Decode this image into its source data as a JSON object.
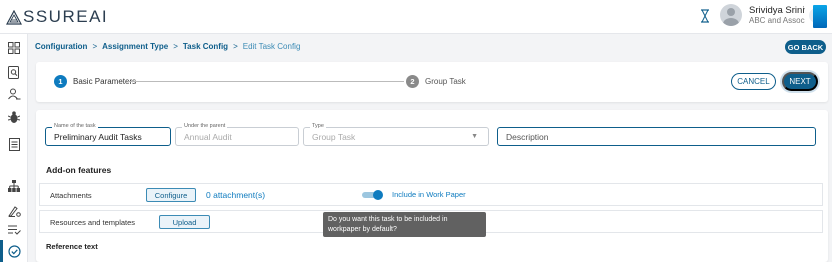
{
  "app": {
    "logo_text": "SSUREAI"
  },
  "user": {
    "name": "Srividya Sriniv...",
    "org": "ABC and Associa..."
  },
  "breadcrumb": {
    "items": [
      "Configuration",
      "Assignment Type",
      "Task Config"
    ],
    "current": "Edit Task Config"
  },
  "go_back_label": "GO BACK",
  "stepper": {
    "steps": [
      {
        "num": "1",
        "label": "Basic Parameters",
        "active": true
      },
      {
        "num": "2",
        "label": "Group Task",
        "active": false
      }
    ],
    "cancel_label": "CANCEL",
    "next_label": "NEXT"
  },
  "form": {
    "task_name": {
      "label": "Name of the task",
      "value": "Preliminary Audit Tasks"
    },
    "parent": {
      "label": "Under the parent",
      "value": "Annual Audit"
    },
    "type": {
      "label": "Type",
      "value": "Group Task"
    },
    "description": {
      "placeholder": "Description"
    }
  },
  "addons": {
    "title": "Add-on features",
    "attachments": {
      "label": "Attachments",
      "button": "Configure",
      "count": "0 attachment(s)",
      "toggle_label": "Include in Work Paper",
      "toggle_on": true
    },
    "resources": {
      "label": "Resources and templates",
      "button": "Upload"
    },
    "tooltip": "Do you want this task to be included in workpaper by default?"
  },
  "reference_text_label": "Reference text",
  "colors": {
    "primary": "#0e5e8b",
    "accent": "#0e7bbf",
    "step_inactive": "#8a8a8a"
  }
}
